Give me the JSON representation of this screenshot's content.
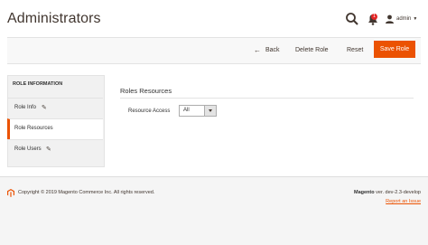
{
  "header": {
    "title": "Administrators",
    "notifications_count": "1",
    "user_name": "admin",
    "icons": {
      "search": "search-icon",
      "bell": "bell-icon",
      "user": "user-icon",
      "caret": "chevron-down-icon"
    }
  },
  "toolbar": {
    "back_label": "Back",
    "delete_label": "Delete Role",
    "reset_label": "Reset",
    "save_label": "Save Role"
  },
  "tabs": {
    "title": "ROLE INFORMATION",
    "items": [
      {
        "label": "Role Info",
        "active": false
      },
      {
        "label": "Role Resources",
        "active": true
      },
      {
        "label": "Role Users",
        "active": false
      }
    ]
  },
  "content": {
    "section_title": "Roles Resources",
    "resource_access_label": "Resource Access",
    "resource_access_value": "All"
  },
  "footer": {
    "copyright": "Copyright © 2019 Magento Commerce Inc. All rights reserved.",
    "brand": "Magento",
    "version": " ver. dev-2.3-develop",
    "report_link": "Report an Issue"
  },
  "colors": {
    "accent": "#eb5202",
    "badge": "#e22626",
    "text": "#303030"
  }
}
